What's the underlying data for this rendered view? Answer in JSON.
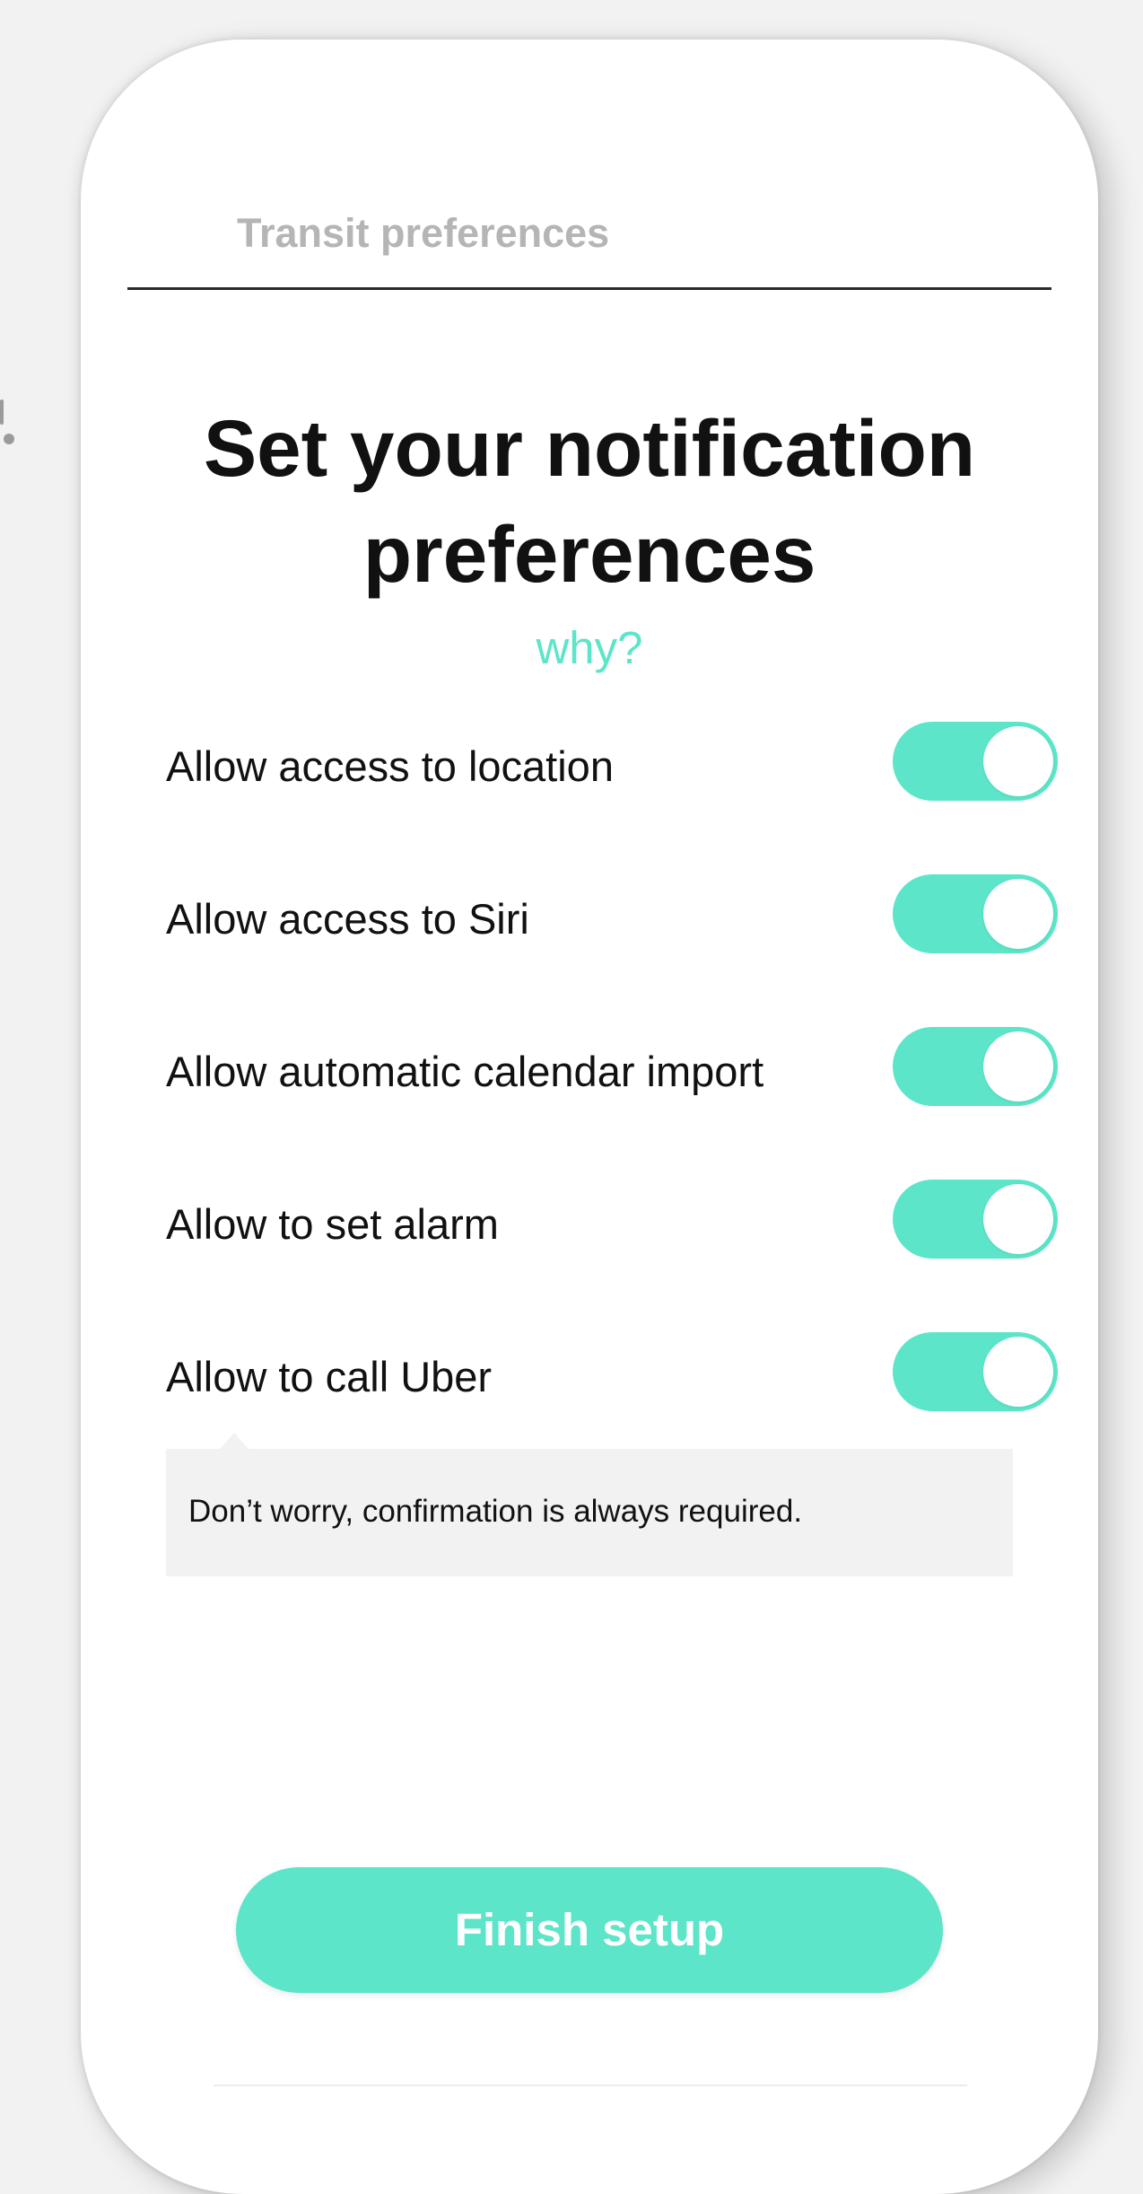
{
  "nav": {
    "title": "Transit preferences"
  },
  "header": {
    "title_line1": "Set your notification",
    "title_line2": "preferences",
    "why_link": "why?"
  },
  "preferences": [
    {
      "label": "Allow access to location",
      "enabled": true
    },
    {
      "label": "Allow access to Siri",
      "enabled": true
    },
    {
      "label": "Allow automatic calendar import",
      "enabled": true
    },
    {
      "label": "Allow to set alarm",
      "enabled": true
    },
    {
      "label": "Allow to call Uber",
      "enabled": true
    }
  ],
  "info": {
    "text": "Don’t worry, confirmation is always required."
  },
  "footer": {
    "finish_button": "Finish setup"
  },
  "colors": {
    "accent": "#5ce5c8",
    "title_gray": "#b5b5b5",
    "info_background": "#f2f2f2",
    "text": "#111111"
  }
}
